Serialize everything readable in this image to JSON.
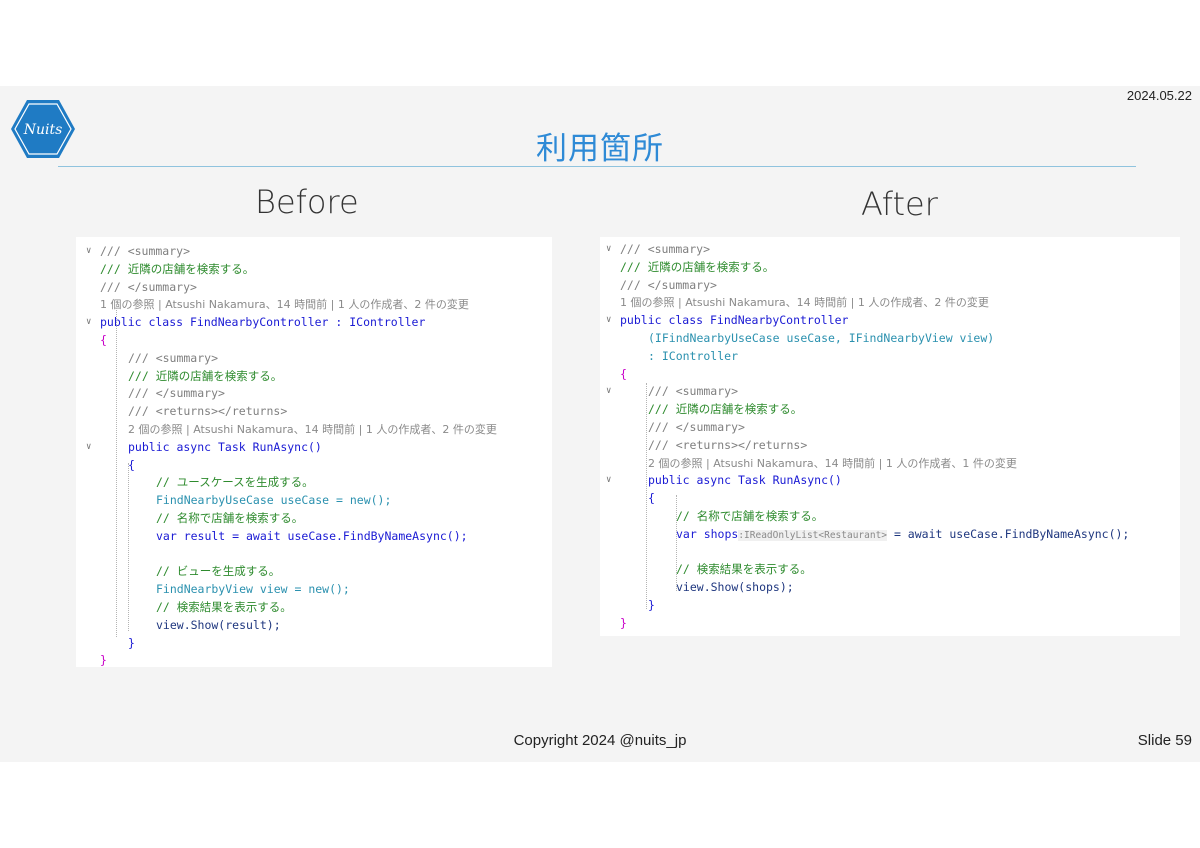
{
  "header": {
    "date": "2024.05.22",
    "title": "利用箇所",
    "logo_text": "Nuits"
  },
  "before": {
    "heading": "Before",
    "lines": [
      {
        "text": "/// <summary>",
        "cls": "c-doc"
      },
      {
        "text": "/// 近隣の店舗を検索する。",
        "cls": "c-com"
      },
      {
        "text": "/// </summary>",
        "cls": "c-doc"
      },
      {
        "text": "1 個の参照 | Atsushi Nakamura、14 時間前 | 1 人の作成者、2 件の変更",
        "cls": "meta"
      },
      {
        "text": "public class FindNearbyController : IController",
        "cls": "c-kw"
      },
      {
        "text": "{",
        "cls": "brace1"
      },
      {
        "text": "/// <summary>",
        "cls": "c-doc"
      },
      {
        "text": "/// 近隣の店舗を検索する。",
        "cls": "c-com"
      },
      {
        "text": "/// </summary>",
        "cls": "c-doc"
      },
      {
        "text": "/// <returns></returns>",
        "cls": "c-doc"
      },
      {
        "text": "2 個の参照 | Atsushi Nakamura、14 時間前 | 1 人の作成者、2 件の変更",
        "cls": "meta"
      },
      {
        "text": "public async Task RunAsync()",
        "cls": "c-kw"
      },
      {
        "text": "{",
        "cls": "brace2"
      },
      {
        "text": "// ユースケースを生成する。",
        "cls": "c-com"
      },
      {
        "text": "FindNearbyUseCase useCase = new();",
        "cls": "c-type"
      },
      {
        "text": "// 名称で店舗を検索する。",
        "cls": "c-com"
      },
      {
        "text": "var result = await useCase.FindByNameAsync();",
        "cls": "c-kw"
      },
      {
        "text": "",
        "cls": "c-txt"
      },
      {
        "text": "// ビューを生成する。",
        "cls": "c-com"
      },
      {
        "text": "FindNearbyView view = new();",
        "cls": "c-type"
      },
      {
        "text": "// 検索結果を表示する。",
        "cls": "c-com"
      },
      {
        "text": "view.Show(result);",
        "cls": "c-id"
      },
      {
        "text": "}",
        "cls": "brace2"
      },
      {
        "text": "}",
        "cls": "brace1"
      }
    ]
  },
  "after": {
    "heading": "After",
    "lines": [
      {
        "text": "/// <summary>",
        "cls": "c-doc"
      },
      {
        "text": "/// 近隣の店舗を検索する。",
        "cls": "c-com"
      },
      {
        "text": "/// </summary>",
        "cls": "c-doc"
      },
      {
        "text": "1 個の参照 | Atsushi Nakamura、14 時間前 | 1 人の作成者、2 件の変更",
        "cls": "meta"
      },
      {
        "text": "public class FindNearbyController",
        "cls": "c-kw"
      },
      {
        "text": "(IFindNearbyUseCase useCase, IFindNearbyView view)",
        "cls": "c-type"
      },
      {
        "text": ": IController",
        "cls": "c-type"
      },
      {
        "text": "{",
        "cls": "brace1"
      },
      {
        "text": "/// <summary>",
        "cls": "c-doc"
      },
      {
        "text": "/// 近隣の店舗を検索する。",
        "cls": "c-com"
      },
      {
        "text": "/// </summary>",
        "cls": "c-doc"
      },
      {
        "text": "/// <returns></returns>",
        "cls": "c-doc"
      },
      {
        "text": "2 個の参照 | Atsushi Nakamura、14 時間前 | 1 人の作成者、1 件の変更",
        "cls": "meta"
      },
      {
        "text": "public async Task RunAsync()",
        "cls": "c-kw"
      },
      {
        "text": "{",
        "cls": "brace2"
      },
      {
        "text": "// 名称で店舗を検索する。",
        "cls": "c-com"
      },
      {
        "text": "var shops",
        "cls": "c-kw"
      },
      {
        "text": "",
        "cls": "c-txt"
      },
      {
        "text": "// 検索結果を表示する。",
        "cls": "c-com"
      },
      {
        "text": "view.Show(shops);",
        "cls": "c-id"
      },
      {
        "text": "}",
        "cls": "brace2"
      },
      {
        "text": "}",
        "cls": "brace1"
      }
    ],
    "inlay_hint": ":IReadOnlyList<Restaurant>",
    "shops_rest": " = await useCase.FindByNameAsync();"
  },
  "footer": {
    "copyright": "Copyright 2024 @nuits_jp",
    "slide": "Slide 59"
  },
  "colors": {
    "title": "#2e8ad6",
    "logo": "#1f7bc4",
    "comment": "#2e8b2e",
    "keyword": "#1a1ad4",
    "type": "#2b91af"
  }
}
